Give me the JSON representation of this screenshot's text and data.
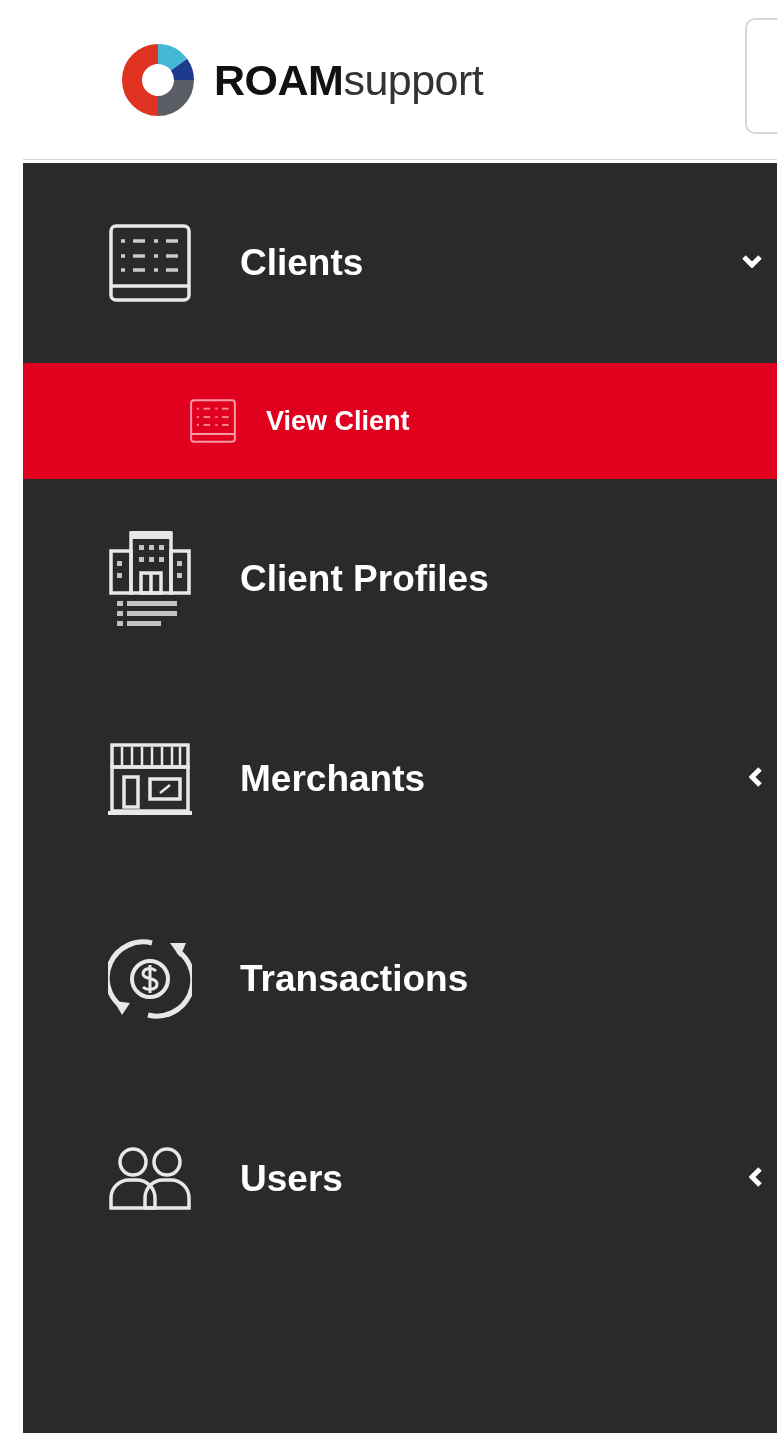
{
  "header": {
    "logo_text": "**ROAM**support"
  },
  "sidebar": {
    "items": [
      {
        "label": "Clients",
        "selected": false,
        "expanded": true,
        "children": [
          {
            "label": "View Client",
            "selected": true
          }
        ]
      },
      {
        "label": "Client Profiles",
        "selected": false
      },
      {
        "label": "Merchants",
        "selected": false,
        "expanded": false
      },
      {
        "label": "Transactions",
        "selected": false
      },
      {
        "label": "Users",
        "selected": false,
        "expanded": false
      }
    ]
  }
}
